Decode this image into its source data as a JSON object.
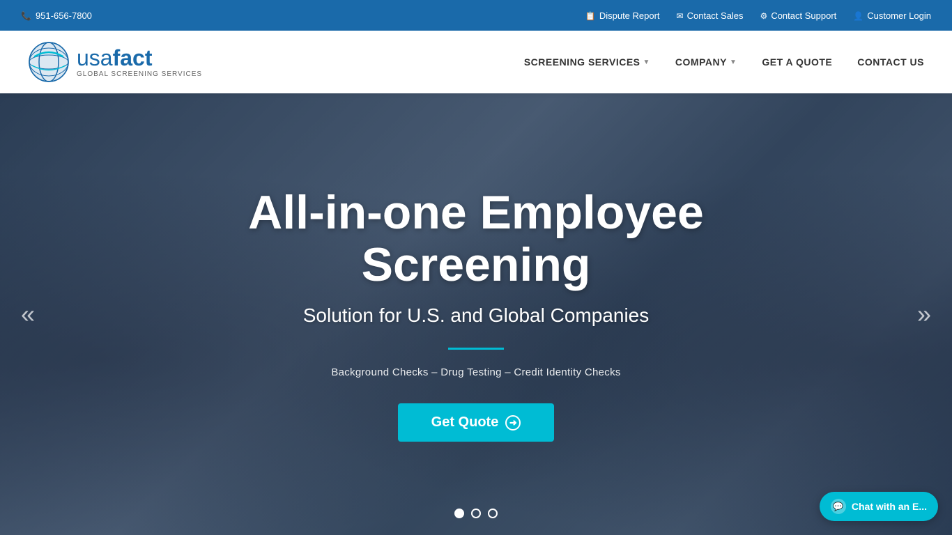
{
  "topbar": {
    "phone": "951-656-7800",
    "dispute_report": "Dispute Report",
    "contact_sales": "Contact Sales",
    "contact_support": "Contact Support",
    "customer_login": "Customer Login"
  },
  "navbar": {
    "logo_text_normal": "usa",
    "logo_text_bold": "fact",
    "logo_tagline": "GLOBAL SCREENING SERVICES",
    "nav_items": [
      {
        "label": "SCREENING SERVICES",
        "has_dropdown": true
      },
      {
        "label": "COMPANY",
        "has_dropdown": true
      },
      {
        "label": "GET A QUOTE",
        "has_dropdown": false
      },
      {
        "label": "CONTACT US",
        "has_dropdown": false
      }
    ]
  },
  "hero": {
    "title": "All-in-one Employee Screening",
    "subtitle": "Solution for U.S. and Global Companies",
    "services_text": "Background Checks – Drug Testing – Credit Identity Checks",
    "cta_button": "Get Quote",
    "prev_arrow": "«",
    "next_arrow": "»"
  },
  "carousel": {
    "dots": [
      {
        "active": true
      },
      {
        "active": false
      },
      {
        "active": false
      }
    ]
  },
  "chat": {
    "label": "Chat with an E..."
  }
}
